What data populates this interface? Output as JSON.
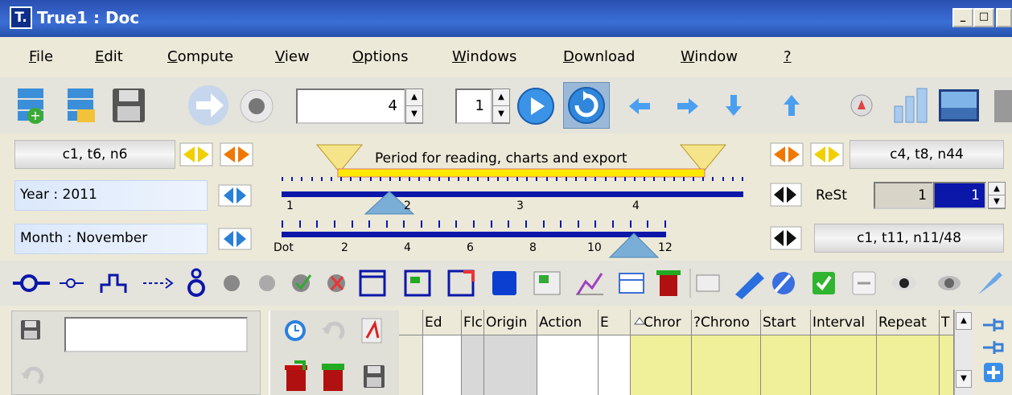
{
  "window": {
    "app_icon_text": "T.",
    "title": "True1 : Doc",
    "minimize": "_",
    "maximize": "□"
  },
  "menu": [
    "File",
    "Edit",
    "Compute",
    "View",
    "Options",
    "Windows",
    "Download",
    "Window",
    "?"
  ],
  "toolbar": {
    "spin_value_1": "4",
    "spin_value_2": "1"
  },
  "period": {
    "left_label": "c1, t6, n6",
    "right_label": "c4, t8, n44",
    "title": "Period for reading, charts and  export",
    "year_label": "Year : 2011",
    "month_label": "Month : November",
    "rest_label": "ReSt",
    "rest_value_1": "1",
    "rest_value_2": "1",
    "bottom_right_label": "c1, t11, n11/48",
    "ruler_top_ticks": [
      "1",
      "2",
      "3",
      "4"
    ],
    "ruler_bottom_ticks": [
      "Dot",
      "2",
      "4",
      "6",
      "8",
      "10",
      "12"
    ]
  },
  "grid": {
    "columns": [
      "Ed",
      "Flc",
      "Origin",
      "Action",
      "E",
      "Chror",
      "?Chrono",
      "Start",
      "Interval",
      "Repeat",
      "T"
    ]
  },
  "colors": {
    "accent_blue": "#0a17a8",
    "grid_yellow": "#f0ef9a",
    "title_blue": "#2a4fb0"
  }
}
